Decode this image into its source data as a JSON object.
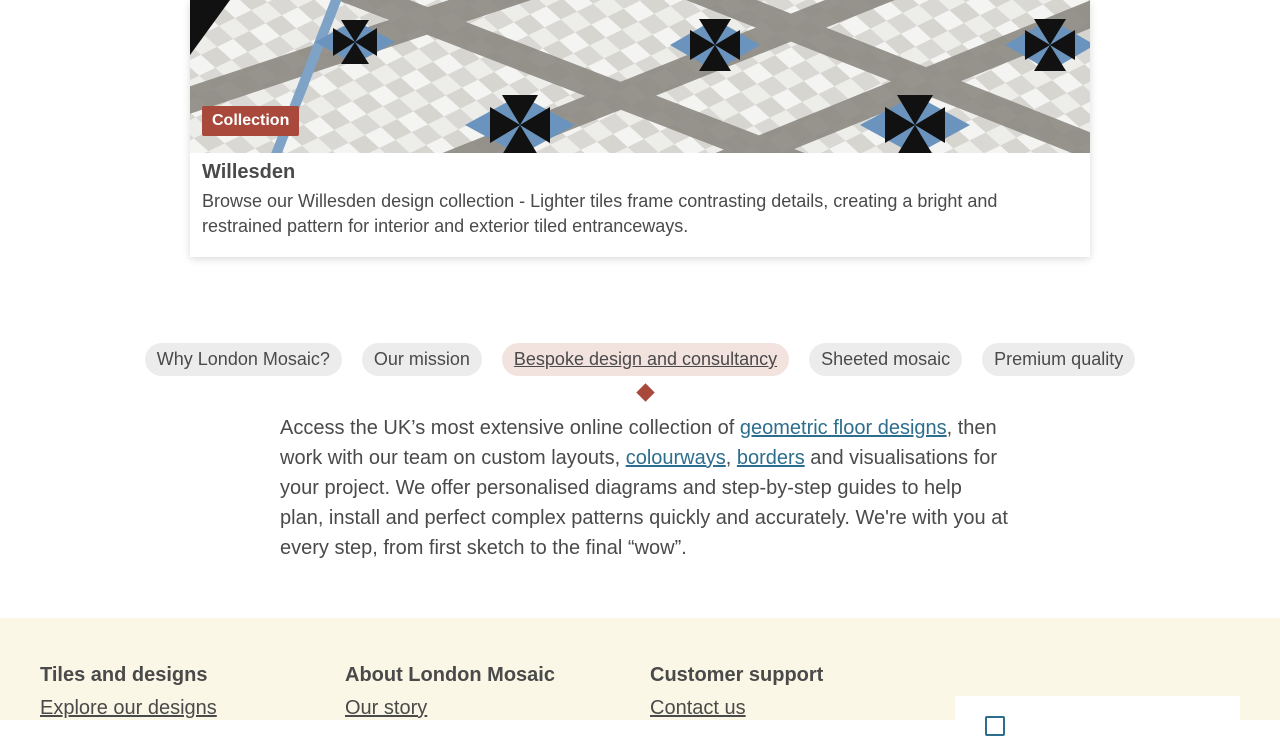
{
  "card": {
    "badge": "Collection",
    "title": "Willesden",
    "description": "Browse our Willesden design collection - Lighter tiles frame contrasting details, creating a bright and restrained pattern for interior and exterior tiled entranceways."
  },
  "tabs": [
    {
      "label": "Why London Mosaic?",
      "active": false
    },
    {
      "label": "Our mission",
      "active": false
    },
    {
      "label": "Bespoke design and consultancy",
      "active": true
    },
    {
      "label": "Sheeted mosaic",
      "active": false
    },
    {
      "label": "Premium quality",
      "active": false
    }
  ],
  "panel": {
    "text_1": "Access the UK’s most extensive online collection of ",
    "link_geometric": "geometric floor designs",
    "text_2": ", then work with our team on custom layouts, ",
    "link_colourways": "colourways",
    "text_3": ", ",
    "link_borders": "borders",
    "text_4": " and visualisations for your project. We offer personalised diagrams and step-by-step guides to help plan, install and perfect complex patterns quickly and accurately. We're with you at every step, from first sketch to the final “wow”."
  },
  "footer": {
    "col1": {
      "heading": "Tiles and designs",
      "link": "Explore our designs"
    },
    "col2": {
      "heading": "About London Mosaic",
      "link": "Our story"
    },
    "col3": {
      "heading": "Customer support",
      "link": "Contact us"
    }
  },
  "colors": {
    "accent": "#a9493c",
    "link": "#2d6e8e",
    "footer_bg": "#faf7e6",
    "active_tab_bg": "#f3e3de"
  }
}
